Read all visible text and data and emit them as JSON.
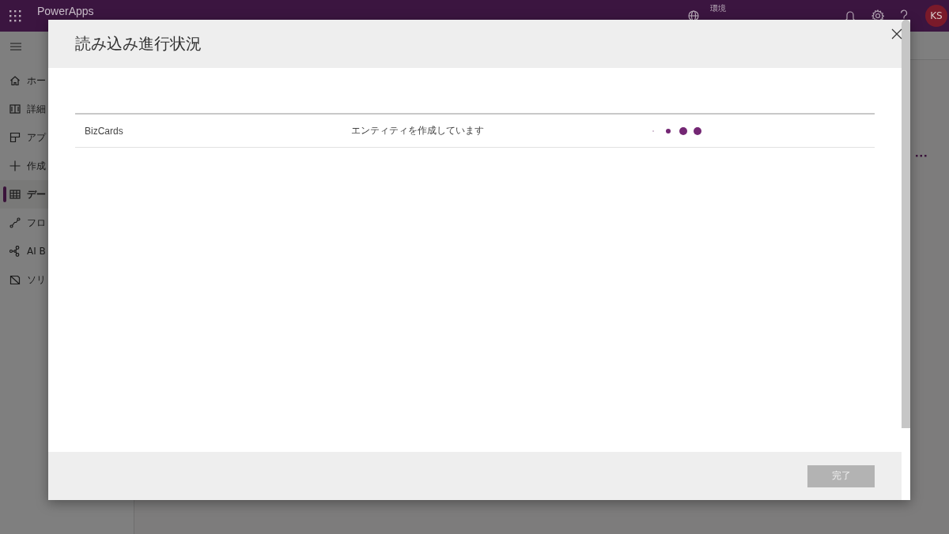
{
  "app_bar": {
    "title": "PowerApps",
    "environment_label": "環境",
    "avatar_initials": "KS"
  },
  "sidebar": {
    "items": [
      {
        "kind": "home",
        "label": "ホー",
        "selected": false
      },
      {
        "kind": "learn",
        "label": "詳細",
        "selected": false
      },
      {
        "kind": "apps",
        "label": "アプ",
        "selected": false
      },
      {
        "kind": "create",
        "label": "作成",
        "selected": false
      },
      {
        "kind": "data",
        "label": "デー",
        "selected": true
      },
      {
        "kind": "flows",
        "label": "フロ",
        "selected": false
      },
      {
        "kind": "builder",
        "label": "AI B",
        "selected": false
      },
      {
        "kind": "solutions",
        "label": "ソリ",
        "selected": false
      }
    ]
  },
  "dialog": {
    "title": "読み込み進行状況",
    "rows": [
      {
        "name": "BizCards",
        "status": "エンティティを作成しています"
      }
    ],
    "footer_button": {
      "label": "完了",
      "disabled": true
    }
  }
}
